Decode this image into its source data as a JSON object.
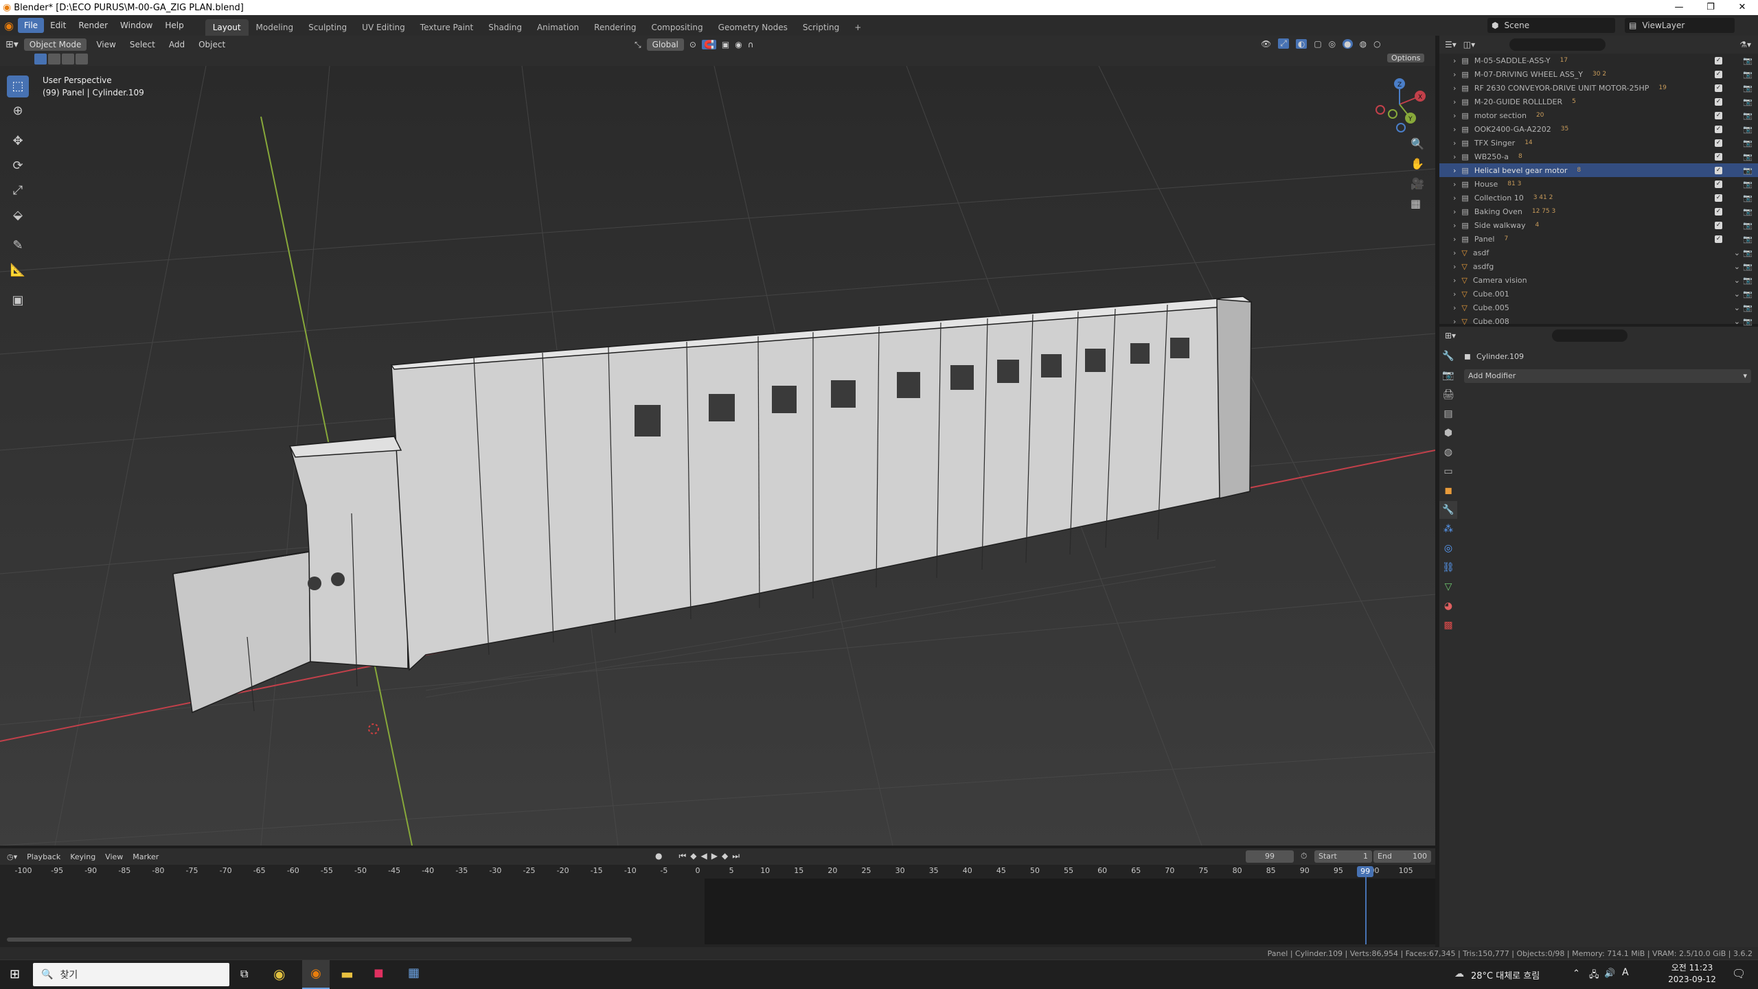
{
  "window": {
    "title": "Blender* [D:\\ECO PURUS\\M-00-GA_ZIG PLAN.blend]",
    "minimize": "—",
    "maximize": "❐",
    "close": "✕"
  },
  "menu": {
    "items": [
      "File",
      "Edit",
      "Render",
      "Window",
      "Help"
    ],
    "active": "File"
  },
  "workspaces": {
    "tabs": [
      "Layout",
      "Modeling",
      "Sculpting",
      "UV Editing",
      "Texture Paint",
      "Shading",
      "Animation",
      "Rendering",
      "Compositing",
      "Geometry Nodes",
      "Scripting"
    ],
    "active": "Layout",
    "add": "+"
  },
  "scene": {
    "label": "Scene",
    "viewlayer": "ViewLayer"
  },
  "viewport_header": {
    "mode": "Object Mode",
    "menus": [
      "View",
      "Select",
      "Add",
      "Object"
    ],
    "orientation": "Global",
    "options": "Options"
  },
  "viewport": {
    "perspective": "User Perspective",
    "object_info": "(99) Panel | Cylinder.109",
    "gizmo": {
      "x": "X",
      "y": "Y",
      "z": "Z"
    }
  },
  "tools": {
    "icons": [
      "select-box-icon",
      "cursor-icon",
      "move-icon",
      "rotate-icon",
      "scale-icon",
      "transform-icon",
      "annotate-icon",
      "measure-icon",
      "add-cube-icon"
    ]
  },
  "outliner": {
    "rows": [
      {
        "name": "M-05-SADDLE-ASS-Y",
        "badge": "17",
        "checked": true,
        "selected": false
      },
      {
        "name": "M-07-DRIVING WHEEL ASS_Y",
        "badge": "30 2",
        "checked": true,
        "selected": false
      },
      {
        "name": "RF 2630 CONVEYOR-DRIVE UNIT MOTOR-25HP",
        "badge": "19",
        "checked": true,
        "selected": false
      },
      {
        "name": "M-20-GUIDE ROLLLDER",
        "badge": "5",
        "checked": true,
        "selected": false
      },
      {
        "name": "motor section",
        "badge": "20",
        "checked": true,
        "selected": false
      },
      {
        "name": "OOK2400-GA-A2202",
        "badge": "35",
        "checked": true,
        "selected": false
      },
      {
        "name": "TFX Singer",
        "badge": "14",
        "checked": true,
        "selected": false
      },
      {
        "name": "WB250-a",
        "badge": "8",
        "checked": true,
        "selected": false
      },
      {
        "name": "Helical bevel gear motor",
        "badge": "8",
        "checked": true,
        "selected": true
      },
      {
        "name": "House",
        "badge": "81 3",
        "checked": true,
        "selected": false
      },
      {
        "name": "Collection 10",
        "badge": "3 41 2",
        "checked": true,
        "selected": false
      },
      {
        "name": "Baking Oven",
        "badge": "12 75 3",
        "checked": true,
        "selected": false
      },
      {
        "name": "Side walkway",
        "badge": "4",
        "checked": true,
        "selected": false
      },
      {
        "name": "Panel",
        "badge": "7",
        "checked": true,
        "selected": false
      },
      {
        "name": "asdf",
        "badge": "",
        "checked": false,
        "selected": false
      },
      {
        "name": "asdfg",
        "badge": "",
        "checked": false,
        "selected": false
      },
      {
        "name": "Camera vision",
        "badge": "",
        "checked": false,
        "selected": false
      },
      {
        "name": "Cube.001",
        "badge": "",
        "checked": false,
        "selected": false
      },
      {
        "name": "Cube.005",
        "badge": "",
        "checked": false,
        "selected": false
      },
      {
        "name": "Cube.008",
        "badge": "",
        "checked": false,
        "selected": false
      }
    ]
  },
  "properties": {
    "object_name": "Cylinder.109",
    "add_modifier": "Add Modifier"
  },
  "timeline": {
    "menus": [
      "Playback",
      "Keying",
      "View",
      "Marker"
    ],
    "current_frame": "99",
    "start_label": "Start",
    "start": "1",
    "end_label": "End",
    "end": "100",
    "ticks": [
      "-100",
      "-95",
      "-90",
      "-85",
      "-80",
      "-75",
      "-70",
      "-65",
      "-60",
      "-55",
      "-50",
      "-45",
      "-40",
      "-35",
      "-30",
      "-25",
      "-20",
      "-15",
      "-10",
      "-5",
      "0",
      "5",
      "10",
      "15",
      "20",
      "25",
      "30",
      "35",
      "40",
      "45",
      "50",
      "55",
      "60",
      "65",
      "70",
      "75",
      "80",
      "85",
      "90",
      "95",
      "100",
      "105"
    ],
    "playhead_label": "99"
  },
  "statusbar": {
    "text": "Panel | Cylinder.109 | Verts:86,954 | Faces:67,345 | Tris:150,777 | Objects:0/98 | Memory: 714.1 MiB | VRAM: 2.5/10.0 GiB | 3.6.2"
  },
  "taskbar": {
    "search_placeholder": "찾기",
    "weather": "28°C 대체로 흐림",
    "ime": "A",
    "time": "오전 11:23",
    "date": "2023-09-12"
  },
  "colors": {
    "accent": "#4772b3",
    "selected_row": "#334d80",
    "x_axis": "#c2404a",
    "y_axis": "#87a83a",
    "playhead": "#4772b3"
  }
}
